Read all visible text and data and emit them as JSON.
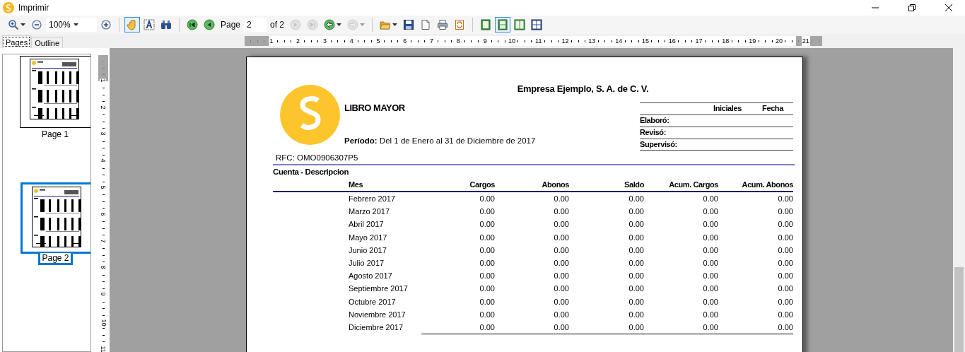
{
  "window": {
    "title": "Imprimir"
  },
  "toolbar": [
    {
      "kind": "button",
      "dropdown": true,
      "selected": false,
      "disabled": false
    },
    {
      "kind": "button",
      "dropdown": false,
      "selected": false,
      "disabled": false
    },
    {
      "kind": "combo",
      "value": "100%"
    },
    {
      "kind": "button",
      "dropdown": false,
      "selected": false,
      "disabled": false
    },
    {
      "kind": "separator"
    },
    {
      "kind": "button",
      "dropdown": false,
      "selected": true,
      "disabled": false
    },
    {
      "kind": "button",
      "dropdown": false,
      "selected": false,
      "disabled": false
    },
    {
      "kind": "button",
      "dropdown": false,
      "selected": false,
      "disabled": false
    },
    {
      "kind": "separator"
    },
    {
      "kind": "button",
      "dropdown": false,
      "selected": false,
      "disabled": false
    },
    {
      "kind": "button",
      "dropdown": false,
      "selected": false,
      "disabled": false
    },
    {
      "kind": "label",
      "text": "Page"
    },
    {
      "kind": "field",
      "value": "2"
    },
    {
      "kind": "label",
      "text": "of 2"
    },
    {
      "kind": "button",
      "dropdown": false,
      "selected": false,
      "disabled": true
    },
    {
      "kind": "button",
      "dropdown": false,
      "selected": false,
      "disabled": true
    },
    {
      "kind": "button",
      "dropdown": true,
      "selected": false,
      "disabled": false
    },
    {
      "kind": "button",
      "dropdown": true,
      "selected": false,
      "disabled": true
    },
    {
      "kind": "separator"
    },
    {
      "kind": "button",
      "dropdown": true,
      "selected": false,
      "disabled": false
    },
    {
      "kind": "button",
      "dropdown": false,
      "selected": false,
      "disabled": false
    },
    {
      "kind": "button",
      "dropdown": false,
      "selected": false,
      "disabled": false
    },
    {
      "kind": "button",
      "dropdown": false,
      "selected": false,
      "disabled": false
    },
    {
      "kind": "button",
      "dropdown": false,
      "selected": false,
      "disabled": false
    },
    {
      "kind": "separator"
    },
    {
      "kind": "button",
      "dropdown": false,
      "selected": false,
      "disabled": false
    },
    {
      "kind": "button",
      "dropdown": false,
      "selected": true,
      "disabled": false
    },
    {
      "kind": "button",
      "dropdown": false,
      "selected": false,
      "disabled": false
    },
    {
      "kind": "button",
      "dropdown": false,
      "selected": false,
      "disabled": false
    }
  ],
  "tabs": [
    {
      "label": "Pages",
      "selected": true
    },
    {
      "label": "Outline",
      "selected": false
    }
  ],
  "ruler": {
    "horizontal": [
      "1",
      "2",
      "3",
      "4",
      "5",
      "6",
      "7",
      "8",
      "9",
      "10",
      "11",
      "12",
      "13",
      "14",
      "15",
      "16",
      "17",
      "18",
      "19",
      "20",
      "21"
    ],
    "vertical": [
      "1",
      "2",
      "3",
      "4",
      "5",
      "6",
      "7",
      "8",
      "9",
      "10",
      "11"
    ]
  },
  "thumbnails": [
    {
      "label": "Page 1",
      "selected": false
    },
    {
      "label": "Page 2",
      "selected": true
    }
  ],
  "report": {
    "company": "Empresa Ejemplo, S. A. de C. V.",
    "title": "LIBRO MAYOR",
    "period": "**Período:** Del 1 de Enero al 31 de Diciembre de 2017",
    "signatures": {
      "columns": [
        "Iniciales",
        "Fecha"
      ],
      "rows": [
        "Elaboró:",
        "Revisó:",
        "Supervisó:"
      ]
    },
    "rfc": "RFC: OMO0906307P5",
    "section": "Cuenta - Descripcion",
    "columns": [
      "Mes",
      "Cargos",
      "Abonos",
      "Saldo",
      "Acum. Cargos",
      "Acum. Abonos"
    ],
    "rows": [
      [
        "Febrero 2017",
        "0.00",
        "0.00",
        "0.00",
        "0.00",
        "0.00"
      ],
      [
        "Marzo 2017",
        "0.00",
        "0.00",
        "0.00",
        "0.00",
        "0.00"
      ],
      [
        "Abril 2017",
        "0.00",
        "0.00",
        "0.00",
        "0.00",
        "0.00"
      ],
      [
        "Mayo 2017",
        "0.00",
        "0.00",
        "0.00",
        "0.00",
        "0.00"
      ],
      [
        "Junio 2017",
        "0.00",
        "0.00",
        "0.00",
        "0.00",
        "0.00"
      ],
      [
        "Julio 2017",
        "0.00",
        "0.00",
        "0.00",
        "0.00",
        "0.00"
      ],
      [
        "Agosto 2017",
        "0.00",
        "0.00",
        "0.00",
        "0.00",
        "0.00"
      ],
      [
        "Septiembre 2017",
        "0.00",
        "0.00",
        "0.00",
        "0.00",
        "0.00"
      ],
      [
        "Octubre 2017",
        "0.00",
        "0.00",
        "0.00",
        "0.00",
        "0.00"
      ],
      [
        "Noviembre 2017",
        "0.00",
        "0.00",
        "0.00",
        "0.00",
        "0.00"
      ],
      [
        "Diciembre 2017",
        "0.00",
        "0.00",
        "0.00",
        "0.00",
        "0.00"
      ]
    ]
  }
}
